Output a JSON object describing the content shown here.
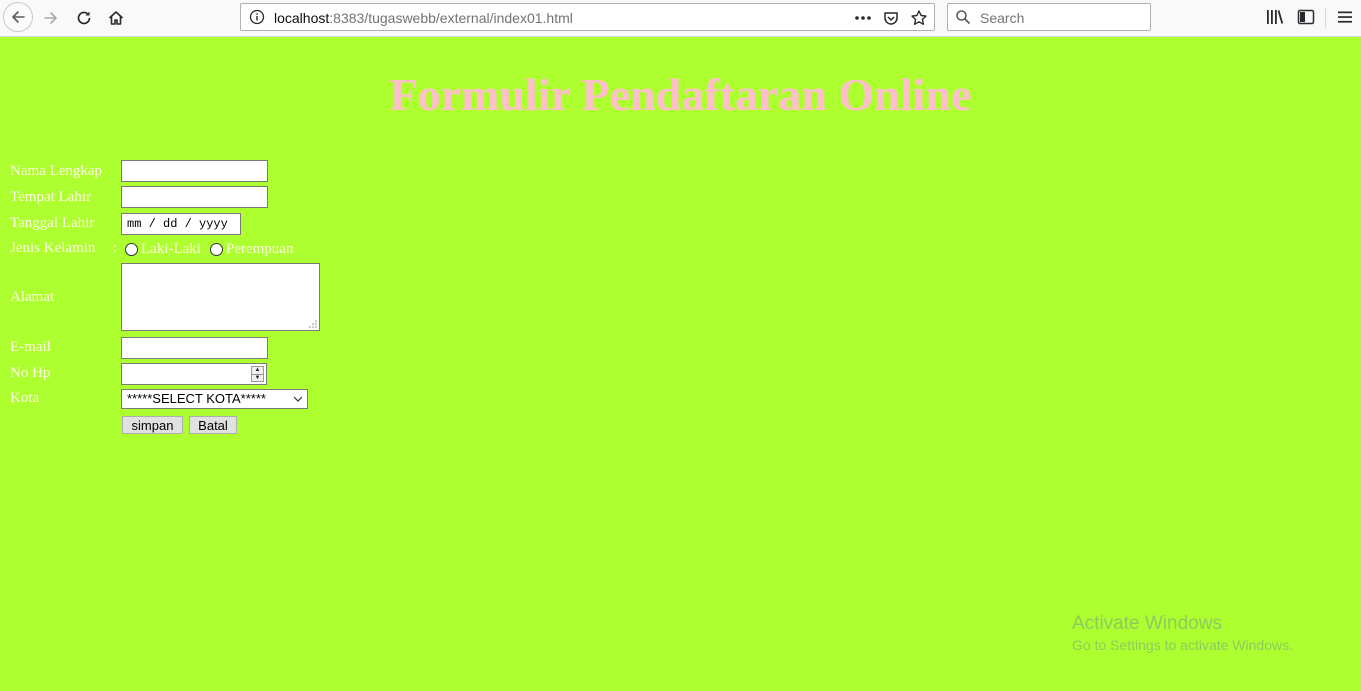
{
  "browser": {
    "url_host": "localhost",
    "url_rest": ":8383/tugaswebb/external/index01.html",
    "search_placeholder": "Search"
  },
  "page": {
    "title": "Formulir Pendaftaran Online",
    "background_color": "#adff2f",
    "title_color": "#ffc0cb",
    "label_color": "#ffffe0"
  },
  "form": {
    "nama_label": "Nama Lengkap",
    "tempat_label": "Tempat Lahir",
    "tanggal_label": "Tanggal Lahir",
    "tanggal_placeholder": "mm / dd / yyyy",
    "jenis_label": "Jenis Kelamin",
    "gender_options": [
      "Laki-Laki",
      "Perempuan"
    ],
    "alamat_label": "Alamat",
    "email_label": "E-mail",
    "nohp_label": "No Hp",
    "kota_label": "Kota",
    "kota_selected": "*****SELECT KOTA*****",
    "colon": ":",
    "submit_label": "simpan",
    "reset_label": "Batal"
  },
  "watermark": {
    "title": "Activate Windows",
    "subtitle": "Go to Settings to activate Windows."
  }
}
